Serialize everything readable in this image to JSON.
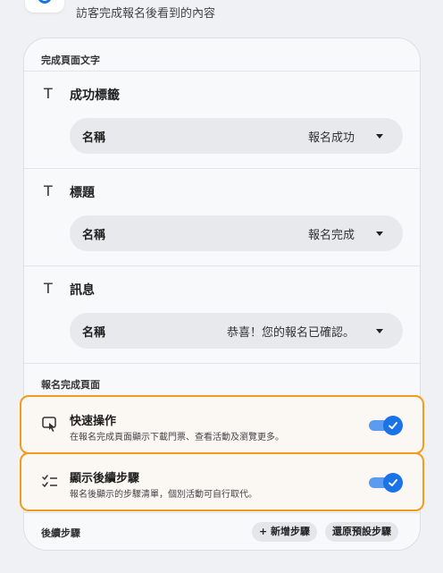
{
  "header": {
    "subtitle": "訪客完成報名後看到的內容"
  },
  "completion_text_section": {
    "label": "完成頁面文字",
    "fields": [
      {
        "title": "成功標籤",
        "key": "名稱",
        "value": "報名成功"
      },
      {
        "title": "標題",
        "key": "名稱",
        "value": "報名完成"
      },
      {
        "title": "訊息",
        "key": "名稱",
        "value": "恭喜！您的報名已確認。"
      }
    ]
  },
  "completion_page_section": {
    "label": "報名完成頁面",
    "toggles": [
      {
        "title": "快速操作",
        "description": "在報名完成頁面顯示下載門票、查看活動及瀏覽更多。",
        "enabled": true,
        "icon": "tap-touch-icon"
      },
      {
        "title": "顯示後續步驟",
        "description": "報名後顯示的步驟清單，個別活動可自行取代。",
        "enabled": true,
        "icon": "checklist-icon"
      }
    ]
  },
  "next_steps": {
    "label": "後續步驟",
    "add_button": "+ 新增步驟",
    "reset_button": "還原預設步驟"
  },
  "colors": {
    "accent": "#1a73e8",
    "highlight": "#f29b1c"
  }
}
